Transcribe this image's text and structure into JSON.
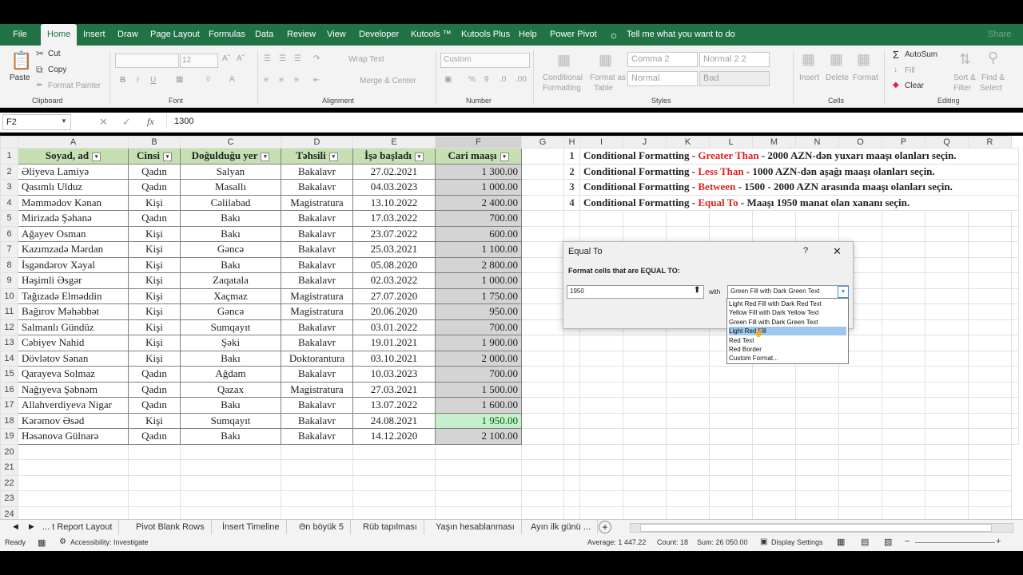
{
  "ribbon_tabs": [
    "File",
    "Home",
    "Insert",
    "Draw",
    "Page Layout",
    "Formulas",
    "Data",
    "Review",
    "View",
    "Developer",
    "Kutools ™",
    "Kutools Plus",
    "Help",
    "Power Pivot"
  ],
  "tell_me": "Tell me what you want to do",
  "share": "Share",
  "clipboard": {
    "paste": "Paste",
    "cut": "Cut",
    "copy": "Copy",
    "format_painter": "Format Painter",
    "label": "Clipboard"
  },
  "font_group": {
    "label": "Font",
    "size": "12"
  },
  "alignment_group": {
    "label": "Alignment",
    "wrap_text": "Wrap Text",
    "merge": "Merge & Center"
  },
  "number_group": {
    "label": "Number",
    "format": "Custom"
  },
  "styles_group": {
    "label": "Styles",
    "conditional": "Conditional",
    "formatting": "Formatting",
    "format_as": "Format as",
    "table": "Table",
    "comma2": "Comma 2",
    "normal22": "Normal 2 2",
    "normal": "Normal",
    "bad": "Bad"
  },
  "cells_group": {
    "label": "Cells",
    "insert": "Insert",
    "delete": "Delete",
    "format": "Format"
  },
  "editing_group": {
    "label": "Editing",
    "autosum": "AutoSum",
    "fill": "Fill",
    "clear": "Clear",
    "sort": "Sort &",
    "filter": "Filter",
    "find": "Find &",
    "select": "Select"
  },
  "formula_bar": {
    "name_box": "F2",
    "formula": "1300",
    "fx": "fx"
  },
  "columns": [
    "A",
    "B",
    "C",
    "D",
    "E",
    "F",
    "G",
    "H",
    "I",
    "J",
    "K",
    "L",
    "M",
    "N",
    "O",
    "P",
    "Q",
    "R"
  ],
  "table_headers": [
    "Soyad, ad",
    "Cinsi",
    "Doğulduğu yer",
    "Təhsili",
    "İşə başladı",
    "Cari maaşı"
  ],
  "rows": [
    [
      "Əliyeva Lamiyə",
      "Qadın",
      "Salyan",
      "Bakalavr",
      "27.02.2021",
      "1 300.00"
    ],
    [
      "Qasımlı Ulduz",
      "Qadın",
      "Masallı",
      "Bakalavr",
      "04.03.2023",
      "1 000.00"
    ],
    [
      "Məmmədov Kənan",
      "Kişi",
      "Cəlilabad",
      "Magistratura",
      "13.10.2022",
      "2 400.00"
    ],
    [
      "Mirizadə Şəhanə",
      "Qadın",
      "Bakı",
      "Bakalavr",
      "17.03.2022",
      "700.00"
    ],
    [
      "Ağayev Osman",
      "Kişi",
      "Bakı",
      "Bakalavr",
      "23.07.2022",
      "600.00"
    ],
    [
      "Kazımzadə Mərdan",
      "Kişi",
      "Gəncə",
      "Bakalavr",
      "25.03.2021",
      "1 100.00"
    ],
    [
      "İsgəndərov Xəyal",
      "Kişi",
      "Bakı",
      "Bakalavr",
      "05.08.2020",
      "2 800.00"
    ],
    [
      "Həşimli Əsgər",
      "Kişi",
      "Zaqatala",
      "Bakalavr",
      "02.03.2022",
      "1 000.00"
    ],
    [
      "Tağızadə Elməddin",
      "Kişi",
      "Xaçmaz",
      "Magistratura",
      "27.07.2020",
      "1 750.00"
    ],
    [
      "Bağırov Məhəbbət",
      "Kişi",
      "Gəncə",
      "Magistratura",
      "20.06.2020",
      "950.00"
    ],
    [
      "Salmanlı Gündüz",
      "Kişi",
      "Sumqayıt",
      "Bakalavr",
      "03.01.2022",
      "700.00"
    ],
    [
      "Cəbiyev Nahid",
      "Kişi",
      "Şəki",
      "Bakalavr",
      "19.01.2021",
      "1 900.00"
    ],
    [
      "Dövlətov Sənan",
      "Kişi",
      "Bakı",
      "Doktorantura",
      "03.10.2021",
      "2 000.00"
    ],
    [
      "Qarayeva Solmaz",
      "Qadın",
      "Ağdam",
      "Bakalavr",
      "10.03.2023",
      "700.00"
    ],
    [
      "Nağıyeva Şəbnəm",
      "Qadın",
      "Qazax",
      "Magistratura",
      "27.03.2021",
      "1 500.00"
    ],
    [
      "Allahverdiyeva Nigar",
      "Qadın",
      "Bakı",
      "Bakalavr",
      "13.07.2022",
      "1 600.00"
    ],
    [
      "Kərəmov Əsəd",
      "Kişi",
      "Sumqayıt",
      "Bakalavr",
      "24.08.2021",
      "1 950.00"
    ],
    [
      "Həsənova Gülnarə",
      "Qadın",
      "Bakı",
      "Bakalavr",
      "14.12.2020",
      "2 100.00"
    ]
  ],
  "empty_rows": [
    "20",
    "21",
    "22",
    "23",
    "24"
  ],
  "tasks": [
    {
      "num": "1",
      "a": "Conditional Formatting - ",
      "b": "Greater Than",
      "c": " - 2000 AZN-dən yuxarı maaşı olanları seçin."
    },
    {
      "num": "2",
      "a": "Conditional Formatting - ",
      "b": "Less Than",
      "c": " - 1000 AZN-dən aşağı maaşı olanları seçin."
    },
    {
      "num": "3",
      "a": "Conditional Formatting - ",
      "b": "Between",
      "c": " - 1500 - 2000 AZN arasında maaşı olanları seçin."
    },
    {
      "num": "4",
      "a": "Conditional Formatting - ",
      "b": "Equal To",
      "c": " - Maaşı 1950 manat olan xananı seçin."
    }
  ],
  "dialog": {
    "title": "Equal To",
    "help": "?",
    "close": "✕",
    "prompt": "Format cells that are EQUAL TO:",
    "value": "1950",
    "with": "with",
    "selected": "Green Fill with Dark Green Text",
    "options": [
      "Light Red Fill with Dark Red Text",
      "Yellow Fill with Dark Yellow Text",
      "Green Fill with Dark Green Text",
      "Light Red Fill",
      "Red Text",
      "Red Border",
      "Custom Format..."
    ],
    "highlighted_index": 3
  },
  "sheet_tabs": [
    "... t Report Layout",
    "Pivot Blank Rows",
    "İnsert Timeline",
    "Ən böyük 5",
    "Rüb tapılması",
    "Yaşın hesablanması",
    "Ayın ilk günü ..."
  ],
  "status": {
    "ready": "Ready",
    "accessibility": "Accessibility: Investigate",
    "average": "Average:  1 447.22",
    "count": "Count: 18",
    "sum": "Sum:  26 050.00",
    "display": "Display Settings"
  },
  "colors": {
    "excel_green": "#217346",
    "header_fill": "#c6e0b4",
    "match_fill": "#c6efce",
    "task_red": "#e02020"
  }
}
